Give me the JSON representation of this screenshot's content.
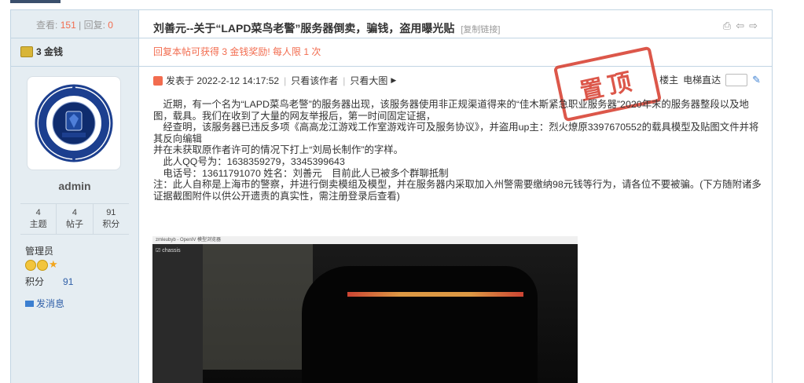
{
  "sidebar": {
    "views_label": "查看:",
    "views": "151",
    "divider": "|",
    "replies_label": "回复:",
    "replies": "0",
    "coin_text": "3 金钱",
    "username": "admin",
    "stats": [
      {
        "value": "4",
        "label": "主题"
      },
      {
        "value": "4",
        "label": "帖子"
      },
      {
        "value": "91",
        "label": "积分"
      }
    ],
    "role": "管理员",
    "points_label": "积分",
    "points_value": "91",
    "message_link": "发消息"
  },
  "post": {
    "title": "刘善元--关于“LAPD菜鸟老警”服务器倒卖，骗钱，盗用曝光贴",
    "copy_link": "[复制链接]",
    "reward_notice": "回复本帖可获得 3 金钱奖励! 每人限 1 次",
    "posted_at": "发表于 2022-2-12 14:17:52",
    "only_author": "只看该作者",
    "only_large": "只看大图",
    "stamp_text": "置顶",
    "floor_label": "楼主",
    "elevator_label": "电梯直达",
    "paragraphs": [
      "　近期，有一个名为“LAPD菜鸟老警”的服务器出现，该服务器使用非正规渠道得来的“佳木斯紧急职业服务器”2020年末的服务器整段以及地图，载具。我们在收到了大量的网友举报后，第一时间固定证据，",
      "　经查明，该服务器已违反多项《高高龙江游戏工作室游戏许可及服务协议》，并盗用up主：烈火燎原3397670552的载具模型及贴图文件并将其反向编辑",
      "并在未获取原作者许可的情况下打上“刘局长制作”的字样。",
      "　此人QQ号为：1638359279，3345399643",
      "　电话号：13611791070 姓名：刘善元　目前此人已被多个群聊抵制",
      "注：此人自称是上海市的警察，并进行倒卖模组及模型，并在服务器内采取加入州警需要缴纳98元钱等行为，请各位不要被骗。(下方随附诸多证据截图附件以供公开遗责的真实性，需注册登录后查看)"
    ],
    "screenshot_window_title": "zmleubyb - OpenIV 模型浏览器",
    "screenshot_tree_item": "chassis"
  },
  "colors": {
    "accent": "#f26c4f",
    "link": "#2f5fa8",
    "border": "#c2d5e3",
    "sidebar_bg": "#e5edf2",
    "stamp": "#d63a2b"
  }
}
